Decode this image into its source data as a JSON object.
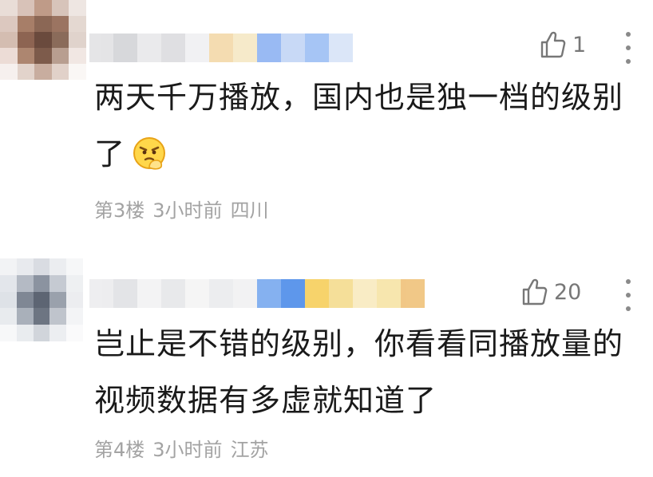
{
  "comments": [
    {
      "likes": "1",
      "text": "两天千万播放，国内也是独一档的级别了",
      "floor": "第3楼",
      "time": "3小时前",
      "location": "四川",
      "emoji": "smirk-hand-emoji"
    },
    {
      "likes": "20",
      "text": "岂止是不错的级别，你看看同播放量的视频数据有多虚就知道了",
      "floor": "第4楼",
      "time": "3小时前",
      "location": "江苏"
    }
  ],
  "icons": {
    "like": "thumbs-up-icon",
    "more": "more-vertical-icon"
  },
  "colors": {
    "meta_text": "#a3a3a3",
    "body_text": "#1a1a1a",
    "icon": "#777777"
  }
}
